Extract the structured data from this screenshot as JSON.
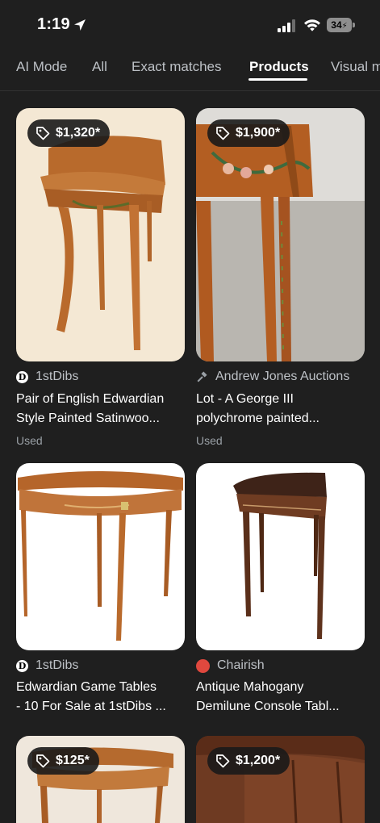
{
  "status_bar": {
    "time": "1:19",
    "battery": "34"
  },
  "tabs": [
    {
      "label": "AI Mode"
    },
    {
      "label": "All"
    },
    {
      "label": "Exact matches"
    },
    {
      "label": "Products"
    },
    {
      "label": "Visual m"
    }
  ],
  "active_tab": "Products",
  "results": [
    {
      "price": "$1,320*",
      "source": "1stDibs",
      "title_lines": [
        "Pair of English Edwardian",
        "Style Painted Satinwoo..."
      ],
      "condition": "Used"
    },
    {
      "price": "$1,900*",
      "source": "Andrew Jones Auctions",
      "title_lines": [
        "Lot - A George III",
        "polychrome painted..."
      ],
      "condition": "Used"
    },
    {
      "price": "",
      "source": "1stDibs",
      "title_lines": [
        "Edwardian Game Tables",
        "- 10 For Sale at 1stDibs ..."
      ],
      "condition": ""
    },
    {
      "price": "",
      "source": "Chairish",
      "title_lines": [
        "Antique Mahogany",
        "Demilune Console Tabl..."
      ],
      "condition": ""
    },
    {
      "price": "$125*",
      "source": "",
      "title_lines": [
        "",
        ""
      ],
      "condition": ""
    },
    {
      "price": "$1,200*",
      "source": "",
      "title_lines": [
        "",
        ""
      ],
      "condition": ""
    }
  ],
  "colors": {
    "background": "#1f1f1f",
    "text_primary": "#ffffff",
    "text_secondary": "#bdc1c6",
    "text_muted": "#9aa0a6",
    "chairish_brand": "#e0483e"
  }
}
